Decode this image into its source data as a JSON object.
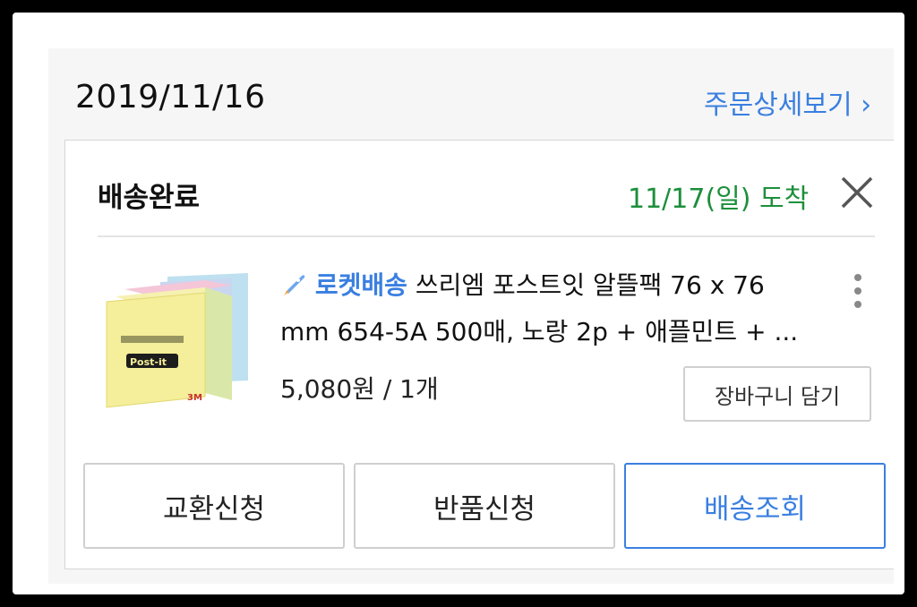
{
  "order": {
    "date": "2019/11/16",
    "detail_link": "주문상세보기 ›"
  },
  "shipment": {
    "status": "배송완료",
    "arrival": "11/17(일) 도착"
  },
  "product": {
    "badge": "로켓배송",
    "title_line1": "쓰리엠 포스트잇 알뜰팩 76 x 76",
    "title_line2": "mm 654-5A 500매, 노랑 2p + 애플민트 + ...",
    "price": "5,080원 / 1개",
    "cart_button": "장바구니 담기",
    "image_brand": "Post-it",
    "image_maker": "3M"
  },
  "actions": {
    "exchange": "교환신청",
    "return": "반품신청",
    "track": "배송조회"
  },
  "colors": {
    "link_blue": "#3a7fe0",
    "arrival_green": "#1d8f3b"
  }
}
